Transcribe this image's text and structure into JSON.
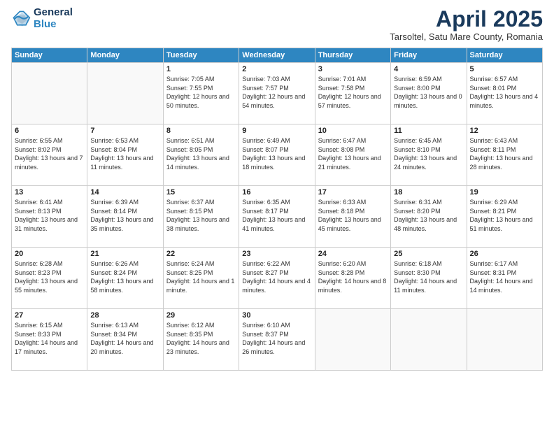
{
  "logo": {
    "line1": "General",
    "line2": "Blue"
  },
  "title": "April 2025",
  "subtitle": "Tarsoltel, Satu Mare County, Romania",
  "days_of_week": [
    "Sunday",
    "Monday",
    "Tuesday",
    "Wednesday",
    "Thursday",
    "Friday",
    "Saturday"
  ],
  "weeks": [
    [
      {
        "day": "",
        "sunrise": "",
        "sunset": "",
        "daylight": ""
      },
      {
        "day": "",
        "sunrise": "",
        "sunset": "",
        "daylight": ""
      },
      {
        "day": "1",
        "sunrise": "Sunrise: 7:05 AM",
        "sunset": "Sunset: 7:55 PM",
        "daylight": "Daylight: 12 hours and 50 minutes."
      },
      {
        "day": "2",
        "sunrise": "Sunrise: 7:03 AM",
        "sunset": "Sunset: 7:57 PM",
        "daylight": "Daylight: 12 hours and 54 minutes."
      },
      {
        "day": "3",
        "sunrise": "Sunrise: 7:01 AM",
        "sunset": "Sunset: 7:58 PM",
        "daylight": "Daylight: 12 hours and 57 minutes."
      },
      {
        "day": "4",
        "sunrise": "Sunrise: 6:59 AM",
        "sunset": "Sunset: 8:00 PM",
        "daylight": "Daylight: 13 hours and 0 minutes."
      },
      {
        "day": "5",
        "sunrise": "Sunrise: 6:57 AM",
        "sunset": "Sunset: 8:01 PM",
        "daylight": "Daylight: 13 hours and 4 minutes."
      }
    ],
    [
      {
        "day": "6",
        "sunrise": "Sunrise: 6:55 AM",
        "sunset": "Sunset: 8:02 PM",
        "daylight": "Daylight: 13 hours and 7 minutes."
      },
      {
        "day": "7",
        "sunrise": "Sunrise: 6:53 AM",
        "sunset": "Sunset: 8:04 PM",
        "daylight": "Daylight: 13 hours and 11 minutes."
      },
      {
        "day": "8",
        "sunrise": "Sunrise: 6:51 AM",
        "sunset": "Sunset: 8:05 PM",
        "daylight": "Daylight: 13 hours and 14 minutes."
      },
      {
        "day": "9",
        "sunrise": "Sunrise: 6:49 AM",
        "sunset": "Sunset: 8:07 PM",
        "daylight": "Daylight: 13 hours and 18 minutes."
      },
      {
        "day": "10",
        "sunrise": "Sunrise: 6:47 AM",
        "sunset": "Sunset: 8:08 PM",
        "daylight": "Daylight: 13 hours and 21 minutes."
      },
      {
        "day": "11",
        "sunrise": "Sunrise: 6:45 AM",
        "sunset": "Sunset: 8:10 PM",
        "daylight": "Daylight: 13 hours and 24 minutes."
      },
      {
        "day": "12",
        "sunrise": "Sunrise: 6:43 AM",
        "sunset": "Sunset: 8:11 PM",
        "daylight": "Daylight: 13 hours and 28 minutes."
      }
    ],
    [
      {
        "day": "13",
        "sunrise": "Sunrise: 6:41 AM",
        "sunset": "Sunset: 8:13 PM",
        "daylight": "Daylight: 13 hours and 31 minutes."
      },
      {
        "day": "14",
        "sunrise": "Sunrise: 6:39 AM",
        "sunset": "Sunset: 8:14 PM",
        "daylight": "Daylight: 13 hours and 35 minutes."
      },
      {
        "day": "15",
        "sunrise": "Sunrise: 6:37 AM",
        "sunset": "Sunset: 8:15 PM",
        "daylight": "Daylight: 13 hours and 38 minutes."
      },
      {
        "day": "16",
        "sunrise": "Sunrise: 6:35 AM",
        "sunset": "Sunset: 8:17 PM",
        "daylight": "Daylight: 13 hours and 41 minutes."
      },
      {
        "day": "17",
        "sunrise": "Sunrise: 6:33 AM",
        "sunset": "Sunset: 8:18 PM",
        "daylight": "Daylight: 13 hours and 45 minutes."
      },
      {
        "day": "18",
        "sunrise": "Sunrise: 6:31 AM",
        "sunset": "Sunset: 8:20 PM",
        "daylight": "Daylight: 13 hours and 48 minutes."
      },
      {
        "day": "19",
        "sunrise": "Sunrise: 6:29 AM",
        "sunset": "Sunset: 8:21 PM",
        "daylight": "Daylight: 13 hours and 51 minutes."
      }
    ],
    [
      {
        "day": "20",
        "sunrise": "Sunrise: 6:28 AM",
        "sunset": "Sunset: 8:23 PM",
        "daylight": "Daylight: 13 hours and 55 minutes."
      },
      {
        "day": "21",
        "sunrise": "Sunrise: 6:26 AM",
        "sunset": "Sunset: 8:24 PM",
        "daylight": "Daylight: 13 hours and 58 minutes."
      },
      {
        "day": "22",
        "sunrise": "Sunrise: 6:24 AM",
        "sunset": "Sunset: 8:25 PM",
        "daylight": "Daylight: 14 hours and 1 minute."
      },
      {
        "day": "23",
        "sunrise": "Sunrise: 6:22 AM",
        "sunset": "Sunset: 8:27 PM",
        "daylight": "Daylight: 14 hours and 4 minutes."
      },
      {
        "day": "24",
        "sunrise": "Sunrise: 6:20 AM",
        "sunset": "Sunset: 8:28 PM",
        "daylight": "Daylight: 14 hours and 8 minutes."
      },
      {
        "day": "25",
        "sunrise": "Sunrise: 6:18 AM",
        "sunset": "Sunset: 8:30 PM",
        "daylight": "Daylight: 14 hours and 11 minutes."
      },
      {
        "day": "26",
        "sunrise": "Sunrise: 6:17 AM",
        "sunset": "Sunset: 8:31 PM",
        "daylight": "Daylight: 14 hours and 14 minutes."
      }
    ],
    [
      {
        "day": "27",
        "sunrise": "Sunrise: 6:15 AM",
        "sunset": "Sunset: 8:33 PM",
        "daylight": "Daylight: 14 hours and 17 minutes."
      },
      {
        "day": "28",
        "sunrise": "Sunrise: 6:13 AM",
        "sunset": "Sunset: 8:34 PM",
        "daylight": "Daylight: 14 hours and 20 minutes."
      },
      {
        "day": "29",
        "sunrise": "Sunrise: 6:12 AM",
        "sunset": "Sunset: 8:35 PM",
        "daylight": "Daylight: 14 hours and 23 minutes."
      },
      {
        "day": "30",
        "sunrise": "Sunrise: 6:10 AM",
        "sunset": "Sunset: 8:37 PM",
        "daylight": "Daylight: 14 hours and 26 minutes."
      },
      {
        "day": "",
        "sunrise": "",
        "sunset": "",
        "daylight": ""
      },
      {
        "day": "",
        "sunrise": "",
        "sunset": "",
        "daylight": ""
      },
      {
        "day": "",
        "sunrise": "",
        "sunset": "",
        "daylight": ""
      }
    ]
  ]
}
